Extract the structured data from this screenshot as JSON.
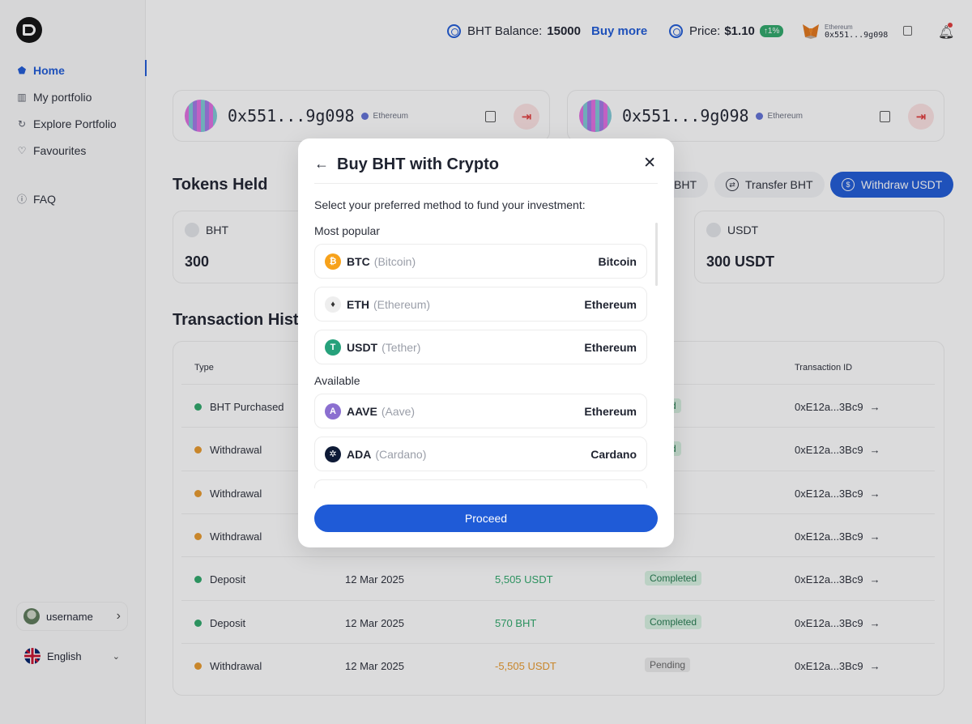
{
  "sidebar": {
    "items": [
      {
        "label": "Home",
        "icon": "home-icon"
      },
      {
        "label": "My portfolio",
        "icon": "bar-chart-icon"
      },
      {
        "label": "Explore Portfolio",
        "icon": "explore-icon"
      },
      {
        "label": "Favourites",
        "icon": "heart-icon"
      },
      {
        "label": "FAQ",
        "icon": "info-icon"
      }
    ],
    "username": "username",
    "language": "English"
  },
  "topbar": {
    "balance_label": "BHT Balance:",
    "balance_value": "15000",
    "buy_more": "Buy more",
    "price_label": "Price:",
    "price_value": "$1.10",
    "price_change": "↑1%",
    "wallet_network": "Ethereum",
    "wallet_address": "0x551...9g098"
  },
  "accounts": [
    {
      "address": "0x551...9g098",
      "network": "Ethereum"
    },
    {
      "address": "0x551...9g098",
      "network": "Ethereum"
    }
  ],
  "tokens": {
    "title": "Tokens Held",
    "actions": [
      "BHT",
      "Transfer BHT",
      "Withdraw USDT"
    ],
    "cards": [
      {
        "name": "BHT",
        "value": "300"
      },
      {
        "name": "USDT",
        "value": "300 USDT"
      }
    ]
  },
  "transactions": {
    "title": "Transaction Hist",
    "headers": {
      "type": "Type",
      "id": "Transaction ID"
    },
    "rows": [
      {
        "type": "BHT Purchased",
        "date": "",
        "amount": "",
        "status": "Completed",
        "id": "0xE12a...3Bc9",
        "icon": "green",
        "status_text": "pleted"
      },
      {
        "type": "Withdrawal",
        "date": "",
        "amount": "",
        "status": "Completed",
        "id": "0xE12a...3Bc9",
        "icon": "orange",
        "status_text": "pleted"
      },
      {
        "type": "Withdrawal",
        "date": "",
        "amount": "",
        "status": "Pending",
        "id": "0xE12a...3Bc9",
        "icon": "orange",
        "status_text": "ding"
      },
      {
        "type": "Withdrawal",
        "date": "",
        "amount": "",
        "status": "Pending",
        "id": "0xE12a...3Bc9",
        "icon": "orange",
        "status_text": "ding"
      },
      {
        "type": "Deposit",
        "date": "12 Mar 2025",
        "amount": "5,505 USDT",
        "status": "Completed",
        "id": "0xE12a...3Bc9",
        "icon": "green",
        "status_text": "Completed"
      },
      {
        "type": "Deposit",
        "date": "12 Mar 2025",
        "amount": "570 BHT",
        "status": "Completed",
        "id": "0xE12a...3Bc9",
        "icon": "green",
        "status_text": "Completed"
      },
      {
        "type": "Withdrawal",
        "date": "12 Mar 2025",
        "amount": "-5,505 USDT",
        "status": "Pending",
        "id": "0xE12a...3Bc9",
        "icon": "orange",
        "status_text": "Pending"
      }
    ]
  },
  "modal": {
    "title": "Buy BHT with Crypto",
    "subtitle": "Select your preferred method to fund your investment:",
    "popular_label": "Most popular",
    "available_label": "Available",
    "popular": [
      {
        "symbol": "BTC",
        "name": "(Bitcoin)",
        "network": "Bitcoin",
        "color": "#f7a21b",
        "glyph": "₿"
      },
      {
        "symbol": "ETH",
        "name": "(Ethereum)",
        "network": "Ethereum",
        "color": "#eeeeee",
        "glyph": "♦"
      },
      {
        "symbol": "USDT",
        "name": "(Tether)",
        "network": "Ethereum",
        "color": "#26a17b",
        "glyph": "T"
      }
    ],
    "available": [
      {
        "symbol": "AAVE",
        "name": "(Aave)",
        "network": "Ethereum",
        "color": "#8b6fd0",
        "glyph": "A"
      },
      {
        "symbol": "ADA",
        "name": "(Cardano)",
        "network": "Cardano",
        "color": "#0e1a36",
        "glyph": "✲"
      }
    ],
    "proceed": "Proceed"
  }
}
